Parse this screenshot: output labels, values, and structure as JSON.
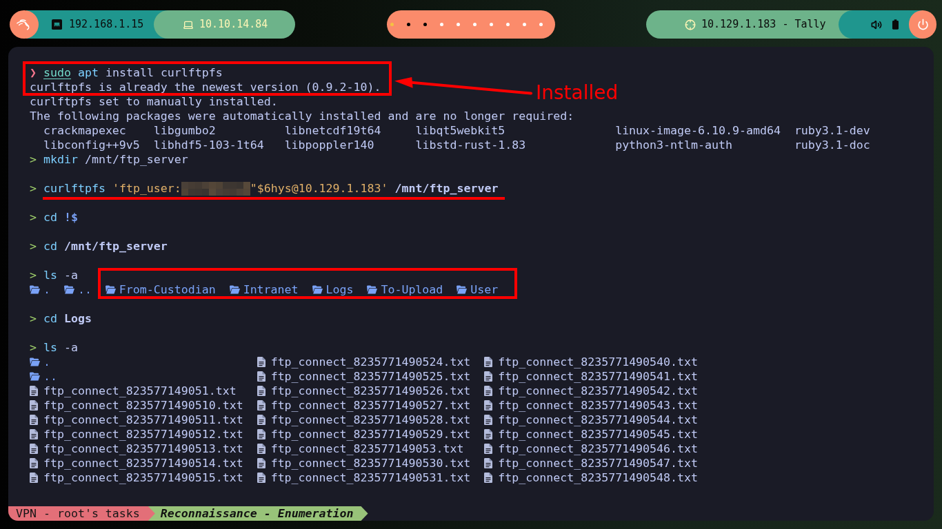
{
  "top_bar": {
    "network": {
      "local_ip": "192.168.1.15",
      "vpn_ip": "10.10.14.84"
    },
    "workspaces": [
      {
        "color": "#f5c242"
      },
      {
        "color": "#000000"
      },
      {
        "color": "#000000"
      },
      {
        "color": "#ffffff"
      },
      {
        "color": "#ffffff"
      },
      {
        "color": "#ffffff"
      },
      {
        "color": "#ffffff"
      },
      {
        "color": "#ffffff"
      },
      {
        "color": "#ffffff"
      },
      {
        "color": "#ffffff"
      }
    ],
    "target": "10.129.1.183 - Tally"
  },
  "terminal": {
    "lines": [
      {
        "kind": "boxed_group",
        "callout": "Installed",
        "lines": [
          {
            "kind": "command",
            "underlined": false,
            "segments": [
              {
                "kind": "prompt_error",
                "text": "❯"
              },
              {
                "kind": "builtin",
                "text": "sudo"
              },
              {
                "kind": "command",
                "text": "apt"
              },
              {
                "kind": "text",
                "text": "install curlftpfs"
              }
            ]
          },
          {
            "kind": "output",
            "text": "curlftpfs is already the newest version (0.9.2-10)."
          }
        ]
      },
      {
        "kind": "output",
        "text": "curlftpfs set to manually installed."
      },
      {
        "kind": "output",
        "text": "The following packages were automatically installed and are no longer required:"
      },
      {
        "kind": "columns",
        "cells": [
          "crackmapexec",
          "libgumbo2",
          "libnetcdf19t64",
          "libqt5webkit5",
          "linux-image-6.10.9-amd64",
          "ruby3.1-dev"
        ]
      },
      {
        "kind": "columns",
        "cells": [
          "libconfig++9v5",
          "libhdf5-103-1t64",
          "libpoppler140",
          "libstd-rust-1.83",
          "python3-ntlm-auth",
          "ruby3.1-doc"
        ]
      },
      {
        "kind": "command",
        "underlined": false,
        "segments": [
          {
            "kind": "prompt",
            "text": ">"
          },
          {
            "kind": "command",
            "text": "mkdir"
          },
          {
            "kind": "text",
            "text": "/mnt/ftp_server"
          }
        ]
      },
      {
        "kind": "blank"
      },
      {
        "kind": "command",
        "underlined": true,
        "segments": [
          {
            "kind": "prompt",
            "text": ">"
          },
          {
            "kind": "command",
            "text": "curlftpfs"
          },
          {
            "kind": "string",
            "text": "'ftp_user:"
          },
          {
            "kind": "redacted"
          },
          {
            "kind": "string",
            "text": "\"$6hys@10.129.1.183'"
          },
          {
            "kind": "path",
            "text": "/mnt/ftp_server"
          }
        ]
      },
      {
        "kind": "blank"
      },
      {
        "kind": "command",
        "underlined": false,
        "segments": [
          {
            "kind": "prompt",
            "text": ">"
          },
          {
            "kind": "command",
            "text": "cd"
          },
          {
            "kind": "expansion",
            "text": "!$"
          }
        ]
      },
      {
        "kind": "blank"
      },
      {
        "kind": "command",
        "underlined": false,
        "segments": [
          {
            "kind": "prompt",
            "text": ">"
          },
          {
            "kind": "command",
            "text": "cd"
          },
          {
            "kind": "path",
            "text": "/mnt/ftp_server"
          }
        ]
      },
      {
        "kind": "blank"
      },
      {
        "kind": "command",
        "underlined": false,
        "segments": [
          {
            "kind": "prompt",
            "text": ">"
          },
          {
            "kind": "command",
            "text": "ls"
          },
          {
            "kind": "text",
            "text": "-a"
          }
        ]
      },
      {
        "kind": "entries",
        "items": [
          {
            "name": ".",
            "kind": "folder",
            "highlighted": false
          },
          {
            "name": "..",
            "kind": "folder",
            "highlighted": false
          },
          {
            "name": "From-Custodian",
            "kind": "folder",
            "highlighted": true
          },
          {
            "name": "Intranet",
            "kind": "folder",
            "highlighted": true
          },
          {
            "name": "Logs",
            "kind": "folder",
            "highlighted": true
          },
          {
            "name": "To-Upload",
            "kind": "folder",
            "highlighted": true
          },
          {
            "name": "User",
            "kind": "folder",
            "highlighted": true
          }
        ]
      },
      {
        "kind": "blank"
      },
      {
        "kind": "command",
        "underlined": false,
        "segments": [
          {
            "kind": "prompt",
            "text": ">"
          },
          {
            "kind": "command",
            "text": "cd"
          },
          {
            "kind": "path",
            "text": "Logs"
          }
        ]
      },
      {
        "kind": "blank"
      },
      {
        "kind": "command",
        "underlined": false,
        "segments": [
          {
            "kind": "prompt",
            "text": ">"
          },
          {
            "kind": "command",
            "text": "ls"
          },
          {
            "kind": "text",
            "text": "-a"
          }
        ]
      },
      {
        "kind": "listing",
        "columns": [
          [
            {
              "name": ".",
              "kind": "folder"
            },
            {
              "name": "..",
              "kind": "folder"
            },
            {
              "name": "ftp_connect_823577149051.txt",
              "kind": "file"
            },
            {
              "name": "ftp_connect_8235771490510.txt",
              "kind": "file"
            },
            {
              "name": "ftp_connect_8235771490511.txt",
              "kind": "file"
            },
            {
              "name": "ftp_connect_8235771490512.txt",
              "kind": "file"
            },
            {
              "name": "ftp_connect_8235771490513.txt",
              "kind": "file"
            },
            {
              "name": "ftp_connect_8235771490514.txt",
              "kind": "file"
            },
            {
              "name": "ftp_connect_8235771490515.txt",
              "kind": "file"
            }
          ],
          [
            {
              "name": "ftp_connect_8235771490524.txt",
              "kind": "file"
            },
            {
              "name": "ftp_connect_8235771490525.txt",
              "kind": "file"
            },
            {
              "name": "ftp_connect_8235771490526.txt",
              "kind": "file"
            },
            {
              "name": "ftp_connect_8235771490527.txt",
              "kind": "file"
            },
            {
              "name": "ftp_connect_8235771490528.txt",
              "kind": "file"
            },
            {
              "name": "ftp_connect_8235771490529.txt",
              "kind": "file"
            },
            {
              "name": "ftp_connect_823577149053.txt",
              "kind": "file"
            },
            {
              "name": "ftp_connect_8235771490530.txt",
              "kind": "file"
            },
            {
              "name": "ftp_connect_8235771490531.txt",
              "kind": "file"
            }
          ],
          [
            {
              "name": "ftp_connect_8235771490540.txt",
              "kind": "file"
            },
            {
              "name": "ftp_connect_8235771490541.txt",
              "kind": "file"
            },
            {
              "name": "ftp_connect_8235771490542.txt",
              "kind": "file"
            },
            {
              "name": "ftp_connect_8235771490543.txt",
              "kind": "file"
            },
            {
              "name": "ftp_connect_8235771490544.txt",
              "kind": "file"
            },
            {
              "name": "ftp_connect_8235771490545.txt",
              "kind": "file"
            },
            {
              "name": "ftp_connect_8235771490546.txt",
              "kind": "file"
            },
            {
              "name": "ftp_connect_8235771490547.txt",
              "kind": "file"
            },
            {
              "name": "ftp_connect_8235771490548.txt",
              "kind": "file"
            }
          ]
        ]
      }
    ]
  },
  "status_bar": {
    "session": "VPN - root's tasks",
    "windows": [
      {
        "label": "Reconnaissance - Enumeration",
        "selected": true
      }
    ]
  }
}
